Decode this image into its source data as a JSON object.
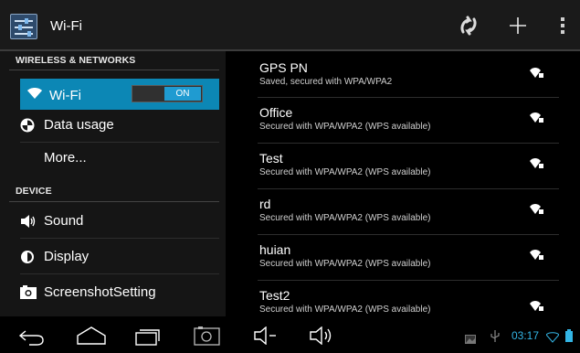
{
  "action_bar": {
    "title": "Wi-Fi",
    "app_icon": "settings-sliders-icon",
    "buttons": [
      "wps-push-icon",
      "add-network-icon",
      "overflow-menu-icon"
    ]
  },
  "sidebar": {
    "sections": [
      {
        "header": "WIRELESS & NETWORKS"
      },
      {
        "header": "DEVICE"
      }
    ],
    "items": [
      {
        "label": "Wi-Fi",
        "icon": "wifi-icon",
        "selected": true,
        "toggle": "ON"
      },
      {
        "label": "Data usage",
        "icon": "data-usage-icon"
      },
      {
        "label": "More...",
        "icon": ""
      },
      {
        "label": "Sound",
        "icon": "speaker-icon"
      },
      {
        "label": "Display",
        "icon": "brightness-icon"
      },
      {
        "label": "ScreenshotSetting",
        "icon": "camera-icon"
      }
    ]
  },
  "networks": [
    {
      "name": "GPS PN",
      "status": "Saved, secured with WPA/WPA2"
    },
    {
      "name": "Office",
      "status": "Secured with WPA/WPA2 (WPS available)"
    },
    {
      "name": "Test",
      "status": "Secured with WPA/WPA2 (WPS available)"
    },
    {
      "name": "rd",
      "status": "Secured with WPA/WPA2 (WPS available)"
    },
    {
      "name": "huian",
      "status": "Secured with WPA/WPA2 (WPS available)"
    },
    {
      "name": "Test2",
      "status": "Secured with WPA/WPA2 (WPS available)"
    }
  ],
  "nav_bar": {
    "buttons": [
      "back-icon",
      "home-icon",
      "recent-apps-icon",
      "screenshot-icon",
      "volume-down-icon",
      "volume-up-icon"
    ],
    "status_icons": [
      "gallery-icon",
      "usb-icon",
      "wifi-status-icon",
      "battery-icon"
    ],
    "time": "03:17"
  },
  "colors": {
    "accent": "#33b5e5",
    "selected_bg": "#0c87b5",
    "toggle_on": "#1f9bd1"
  }
}
